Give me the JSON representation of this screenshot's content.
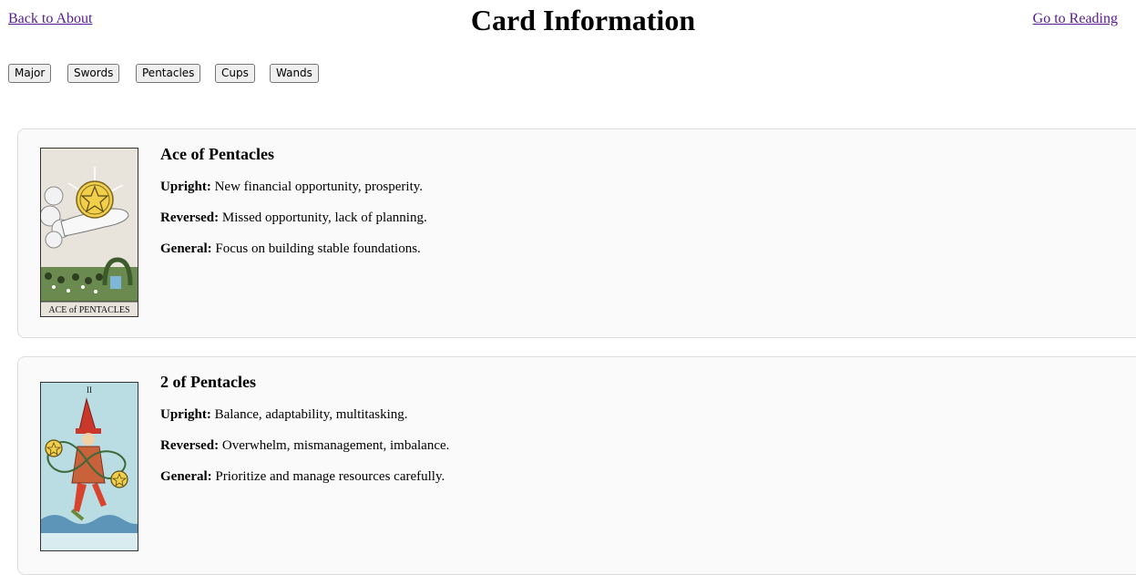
{
  "header": {
    "back_link": "Back to About",
    "title": "Card Information",
    "reading_link": "Go to Reading"
  },
  "filters": [
    "Major",
    "Swords",
    "Pentacles",
    "Cups",
    "Wands"
  ],
  "labels": {
    "upright": "Upright:",
    "reversed": "Reversed:",
    "general": "General:"
  },
  "cards": [
    {
      "name": "Ace of Pentacles",
      "image_caption": "ACE of PENTACLES",
      "upright": "New financial opportunity, prosperity.",
      "reversed": "Missed opportunity, lack of planning.",
      "general": "Focus on building stable foundations."
    },
    {
      "name": "2 of Pentacles",
      "image_numeral": "II",
      "upright": "Balance, adaptability, multitasking.",
      "reversed": "Overwhelm, mismanagement, imbalance.",
      "general": "Prioritize and manage resources carefully."
    }
  ]
}
